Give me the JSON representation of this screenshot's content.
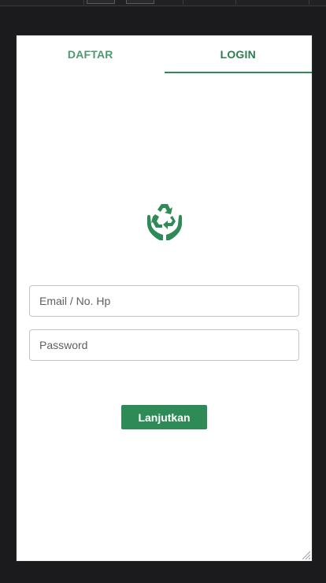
{
  "tabs": [
    {
      "label": "DAFTAR",
      "active": false
    },
    {
      "label": "LOGIN",
      "active": true
    }
  ],
  "logo": {
    "icon": "recycle-hands-icon"
  },
  "form": {
    "email_placeholder": "Email / No. Hp",
    "password_placeholder": "Password",
    "submit_label": "Lanjutkan"
  },
  "colors": {
    "primary": "#2e8b57",
    "tab_inactive": "#4d9a6e",
    "tab_active": "#2e7d4f",
    "page_background": "#1b1b1d",
    "panel_background": "#ffffff"
  }
}
